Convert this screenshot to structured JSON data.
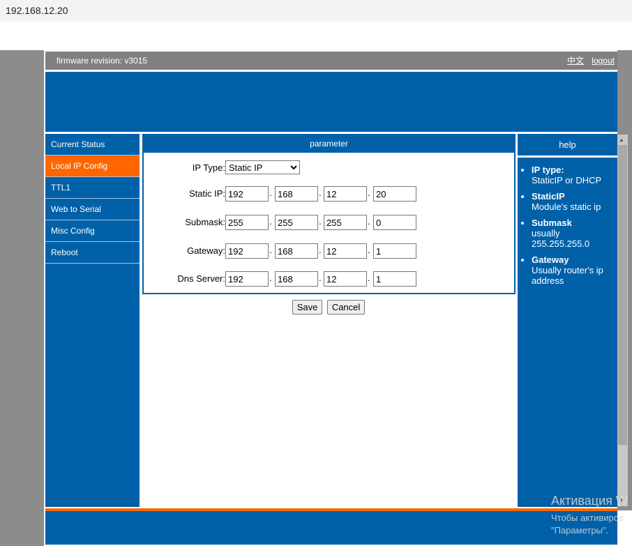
{
  "browser": {
    "url": "192.168.12.20"
  },
  "header": {
    "firmware_label": "firmware revision:",
    "firmware_value": "v3015",
    "lang_link": "中文",
    "logout_link": "logout"
  },
  "sidebar": {
    "items": [
      {
        "label": "Current Status",
        "active": false
      },
      {
        "label": "Local IP Config",
        "active": true
      },
      {
        "label": "TTL1",
        "active": false
      },
      {
        "label": "Web to Serial",
        "active": false
      },
      {
        "label": "Misc Config",
        "active": false
      },
      {
        "label": "Reboot",
        "active": false
      }
    ]
  },
  "main": {
    "panel_title": "parameter",
    "ip_type": {
      "label": "IP Type:",
      "selected": "Static IP"
    },
    "static_ip": {
      "label": "Static IP:",
      "octets": [
        "192",
        "168",
        "12",
        "20"
      ]
    },
    "submask": {
      "label": "Submask:",
      "octets": [
        "255",
        "255",
        "255",
        "0"
      ]
    },
    "gateway": {
      "label": "Gateway:",
      "octets": [
        "192",
        "168",
        "12",
        "1"
      ]
    },
    "dns": {
      "label": "Dns Server:",
      "octets": [
        "192",
        "168",
        "12",
        "1"
      ]
    },
    "save_label": "Save",
    "cancel_label": "Cancel"
  },
  "help": {
    "title": "help",
    "items": [
      {
        "term": "IP type:",
        "desc": "StaticIP or DHCP"
      },
      {
        "term": "StaticIP",
        "desc": "Module's static ip"
      },
      {
        "term": "Submask",
        "desc": "usually 255.255.255.0"
      },
      {
        "term": "Gateway",
        "desc": "Usually router's ip address"
      }
    ]
  },
  "watermark": {
    "line1": "Активация W",
    "line2": "Чтобы активиров",
    "line3": "\"Параметры\"."
  },
  "colors": {
    "primary": "#0060a8",
    "accent": "#ff6600",
    "header_gray": "#808080"
  }
}
